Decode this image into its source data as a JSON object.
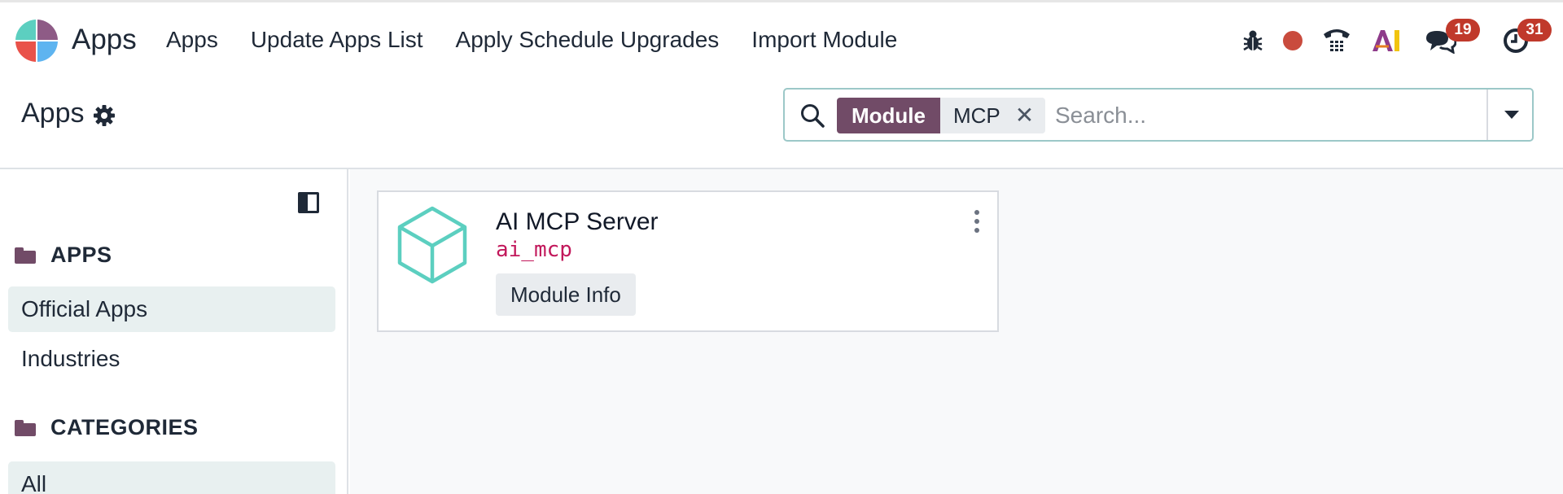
{
  "navbar": {
    "app_name": "Apps",
    "menu": [
      "Apps",
      "Update Apps List",
      "Apply Schedule Upgrades",
      "Import Module"
    ],
    "systray": {
      "debug_icon": "bug-icon",
      "status_dot_color": "#c94b3d",
      "phone_icon": "phone-icon",
      "ai_icon": "ai-logo-icon",
      "messages_badge": "19",
      "activities_badge": "31"
    }
  },
  "control_panel": {
    "title": "Apps",
    "search": {
      "facet_label": "Module",
      "facet_value": "MCP",
      "placeholder": "Search..."
    }
  },
  "sidebar": {
    "sections": [
      {
        "label": "APPS",
        "items": [
          {
            "label": "Official Apps",
            "active": true
          },
          {
            "label": "Industries",
            "active": false
          }
        ]
      },
      {
        "label": "CATEGORIES",
        "items": [
          {
            "label": "All",
            "active": true
          }
        ]
      }
    ]
  },
  "modules": [
    {
      "name": "AI MCP Server",
      "technical_name": "ai_mcp",
      "button_label": "Module Info"
    }
  ],
  "colors": {
    "accent": "#714b67",
    "badge": "#c0392b",
    "module_icon": "#5ccfc0",
    "tech_name": "#c2185b"
  }
}
